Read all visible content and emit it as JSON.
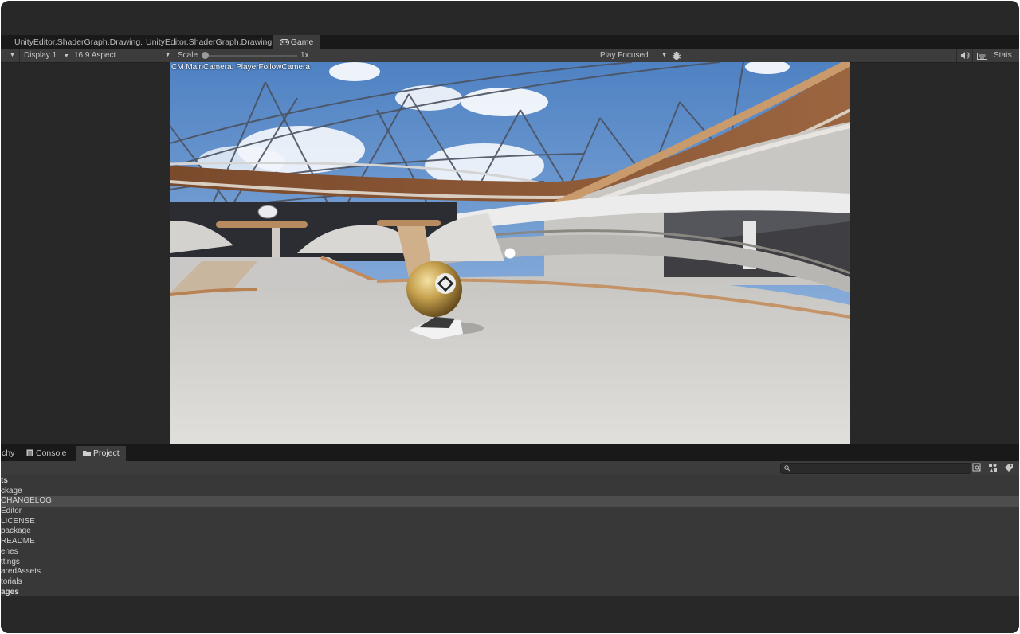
{
  "tabs": [
    {
      "label": "UnityEditor.ShaderGraph.Drawing.MaterialGraphEditWindow"
    },
    {
      "label": "UnityEditor.ShaderGraph.Drawing.MaterialGraphEditWindow"
    },
    {
      "label": "Game",
      "icon": "gamepad-icon"
    }
  ],
  "gamebar": {
    "display": "Display 1",
    "aspect": "16:9 Aspect",
    "scale_label": "Scale",
    "scale_value": "1x",
    "scale_fraction": 0.0,
    "play_mode": "Play Focused",
    "stats": "Stats",
    "icons": [
      "bug-icon",
      "audio-icon",
      "keyboard-icon"
    ]
  },
  "viewport": {
    "camera_label": "CM MainCamera: PlayerFollowCamera"
  },
  "bottom_tabs": [
    {
      "label": "Hierarchy",
      "visible": "chy"
    },
    {
      "label": "Console",
      "icon": "console-icon"
    },
    {
      "label": "Project",
      "icon": "folder-icon"
    }
  ],
  "project": {
    "search_value": "",
    "rows": [
      {
        "text": "ts",
        "bold": true
      },
      {
        "text": "ckage"
      },
      {
        "text": "CHANGELOG",
        "selected": true
      },
      {
        "text": "Editor"
      },
      {
        "text": "LICENSE"
      },
      {
        "text": "package"
      },
      {
        "text": "README"
      },
      {
        "text": "enes"
      },
      {
        "text": "ttings"
      },
      {
        "text": "aredAssets"
      },
      {
        "text": "torials"
      },
      {
        "text": "ages",
        "bold": true
      }
    ]
  }
}
